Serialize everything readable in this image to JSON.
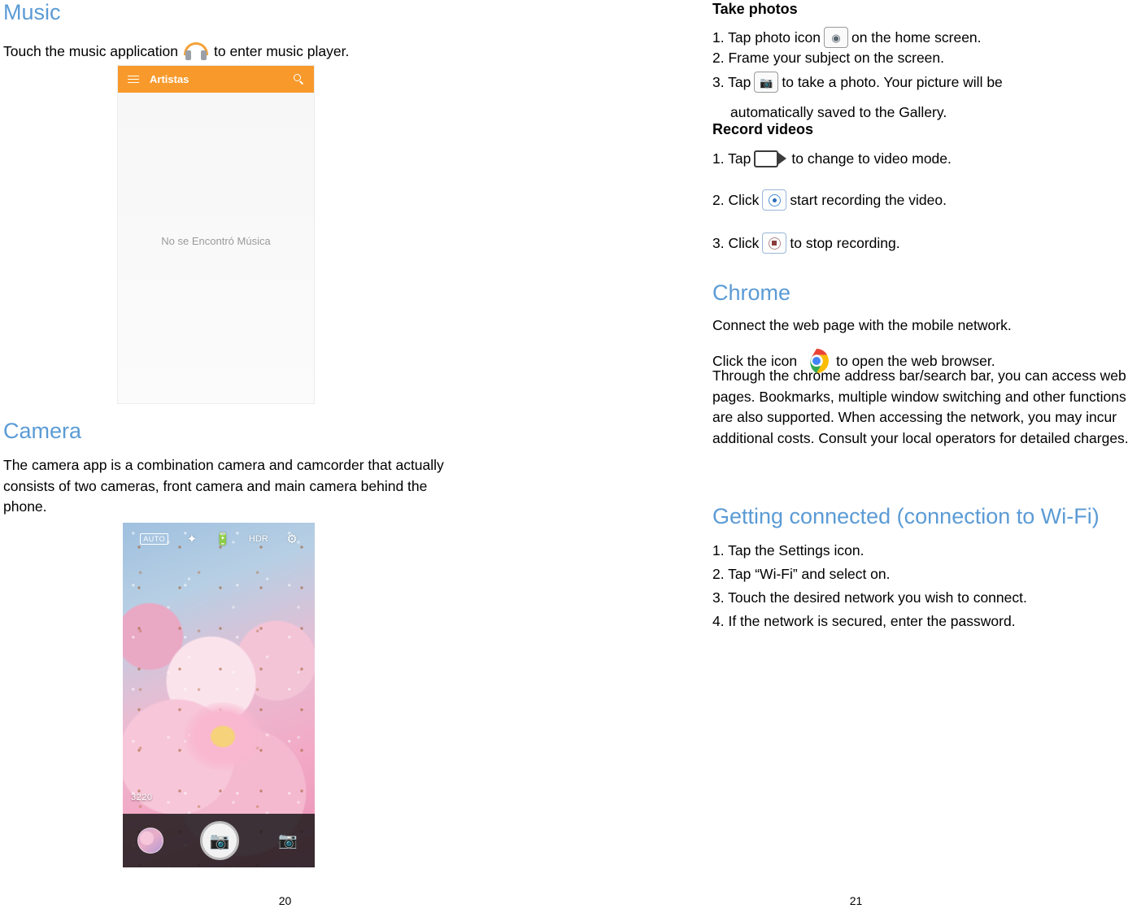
{
  "left_page": {
    "music": {
      "title": "Music",
      "intro_before": "Touch the music application",
      "intro_after": "to enter music player.",
      "icon": "headphones-icon",
      "screenshot": {
        "appbar_title": "Artistas",
        "menu_icon": "hamburger-menu-icon",
        "search_icon": "search-icon",
        "empty_text": "No se Encontró Música",
        "appbar_color": "#f79a2b"
      }
    },
    "camera": {
      "title": "Camera",
      "paragraph": "The camera app is a combination camera and camcorder that actually consists of two cameras, front camera and main camera behind the phone.",
      "screenshot": {
        "auto_badge": "AUTO",
        "top_icons": [
          "magic-wand-icon",
          "flash-icon",
          "hdr-icon",
          "settings-gear-icon"
        ],
        "hdr_label": "HDR",
        "resolution": "3220",
        "gallery_thumb": "gallery-thumbnail",
        "shutter": "shutter-button",
        "switch_camera": "switch-camera-icon"
      }
    },
    "page_number": "20"
  },
  "right_page": {
    "take_photos": {
      "heading": "Take photos",
      "steps": [
        {
          "num": "1. Tap photo icon",
          "icon": "photo-app-icon",
          "rest": "on the home screen."
        },
        {
          "num": "2. Frame your subject on the screen.",
          "icon": "",
          "rest": ""
        },
        {
          "num": "3. Tap",
          "icon": "camera-shutter-icon",
          "rest": "to take a photo. Your picture will be"
        }
      ],
      "step3_cont": "automatically saved to the Gallery."
    },
    "record_videos": {
      "heading": "Record videos",
      "step1_before": "1. Tap",
      "step1_icon": "video-mode-icon",
      "step1_after": "to change to video mode.",
      "step2_before": "2. Click",
      "step2_icon": "record-start-icon",
      "step2_after": "start recording the video.",
      "step3_before": "3. Click",
      "step3_icon": "record-stop-icon",
      "step3_after": "to stop recording."
    },
    "chrome": {
      "title": "Chrome",
      "line1": "Connect the web page with the mobile network.",
      "line2_before": "Click the icon",
      "icon": "chrome-icon",
      "line2_after": "to open the web browser.",
      "paragraph": "Through the chrome address bar/search bar, you can access web pages. Bookmarks, multiple window switching and other functions are also supported. When accessing the network, you may incur additional costs. Consult your local operators for detailed charges."
    },
    "getting_connected": {
      "title": "Getting connected (connection to Wi-Fi)",
      "steps": [
        "1. Tap the Settings icon.",
        "2. Tap “Wi-Fi” and select on.",
        "3. Touch the desired network you wish to connect.",
        "4. If the network is secured, enter the password."
      ]
    },
    "page_number": "21"
  },
  "colors": {
    "heading_blue": "#5b9bd5",
    "music_orange": "#f79a2b"
  }
}
